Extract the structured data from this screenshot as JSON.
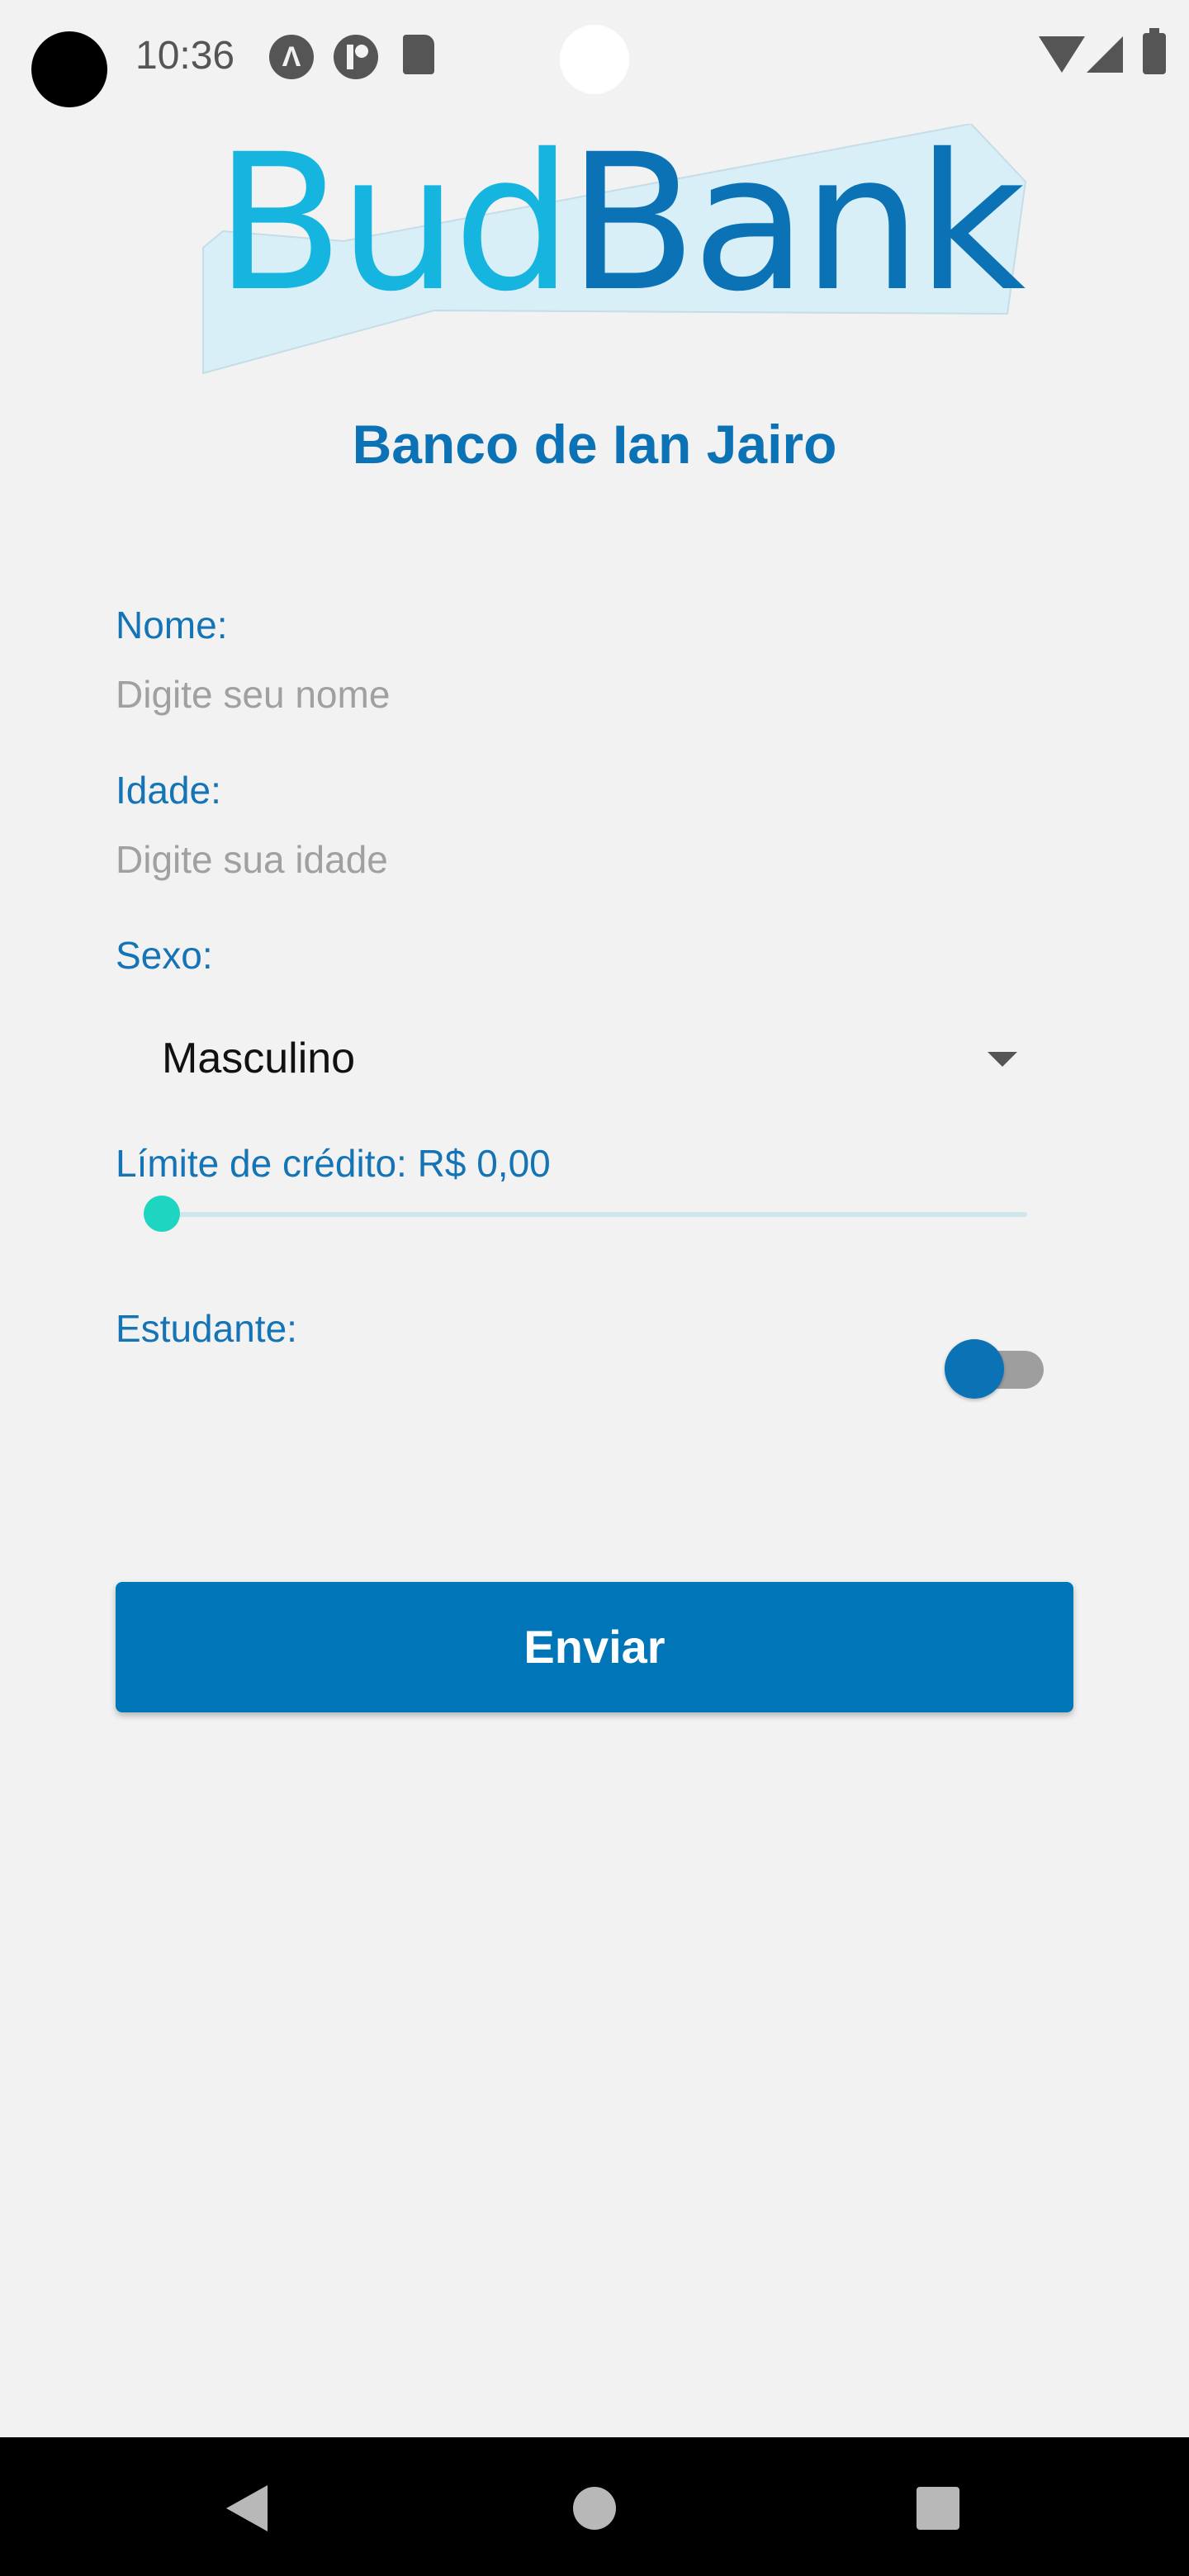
{
  "status_bar": {
    "time": "10:36",
    "icons": [
      "camera-cutout-icon",
      "a-notification-icon",
      "p-notification-icon",
      "sd-card-icon",
      "wifi-icon",
      "signal-icon",
      "battery-icon"
    ]
  },
  "logo": {
    "part1": "Bud",
    "part2": "Bank",
    "colors": {
      "bud": "#16b5e0",
      "bank": "#0b73b5",
      "background": "#d8eff7"
    }
  },
  "header": {
    "title": "Banco de Ian Jairo"
  },
  "form": {
    "name": {
      "label": "Nome:",
      "placeholder": "Digite seu nome",
      "value": ""
    },
    "age": {
      "label": "Idade:",
      "placeholder": "Digite sua idade",
      "value": ""
    },
    "sex": {
      "label": "Sexo:",
      "selected": "Masculino"
    },
    "credit_limit": {
      "label": "Límite de crédito: R$ 0,00",
      "value": 0
    },
    "student": {
      "label": "Estudante:",
      "checked": false
    },
    "submit_label": "Enviar"
  },
  "theme": {
    "primary": "#0075b8",
    "accent": "#1dd5c0",
    "background": "#f2f2f2"
  },
  "nav_bar": {
    "buttons": [
      "back-icon",
      "home-icon",
      "recents-icon"
    ]
  }
}
